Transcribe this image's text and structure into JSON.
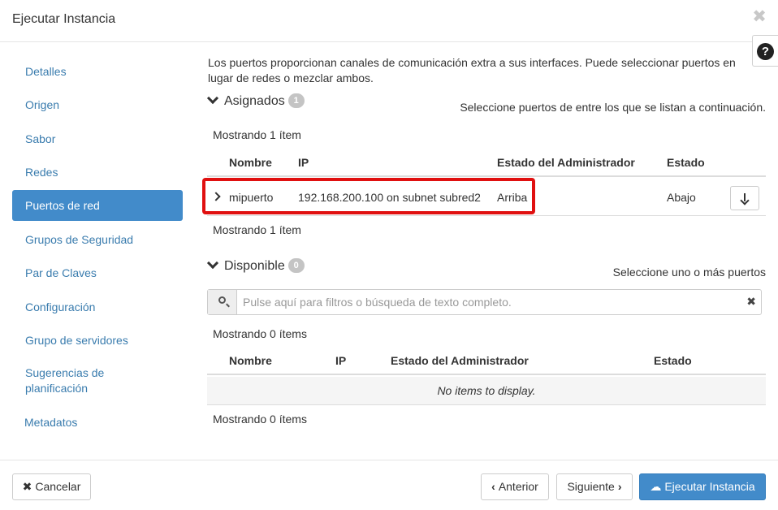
{
  "modal": {
    "title": "Ejecutar Instancia",
    "close_glyph": "✖",
    "help_glyph": "?"
  },
  "sidebar": {
    "items": [
      {
        "label": "Detalles"
      },
      {
        "label": "Origen"
      },
      {
        "label": "Sabor"
      },
      {
        "label": "Redes"
      },
      {
        "label": "Puertos de red",
        "active": true
      },
      {
        "label": "Grupos de Seguridad"
      },
      {
        "label": "Par de Claves"
      },
      {
        "label": "Configuración"
      },
      {
        "label": "Grupo de servidores"
      },
      {
        "label_line1": "Sugerencias de",
        "label_line2": "planificación"
      },
      {
        "label": "Metadatos"
      }
    ]
  },
  "main": {
    "description_line1": "Los puertos proporcionan canales de comunicación extra a sus interfaces. Puede seleccionar puertos en",
    "description_line2": "lugar de redes o mezclar ambos.",
    "assigned": {
      "title": "Asignados",
      "badge": "1",
      "hint": "Seleccione puertos de entre los que se listan a continuación.",
      "count_top": "Mostrando 1 ítem",
      "count_bottom": "Mostrando 1 ítem",
      "columns": [
        "Nombre",
        "IP",
        "Estado del Administrador",
        "Estado"
      ],
      "rows": [
        {
          "name": "mipuerto",
          "ip": "192.168.200.100 on subnet subred2",
          "admin_state": "Arriba",
          "state": "Abajo"
        }
      ]
    },
    "available": {
      "title": "Disponible",
      "badge": "0",
      "hint": "Seleccione uno o más puertos",
      "search_placeholder": "Pulse aquí para filtros o búsqueda de texto completo.",
      "count_top": "Mostrando 0 ítems",
      "count_bottom": "Mostrando 0 ítems",
      "columns": [
        "Nombre",
        "IP",
        "Estado del Administrador",
        "Estado"
      ],
      "empty_text": "No items to display."
    }
  },
  "footer": {
    "cancel_label": "Cancelar",
    "prev_label": "Anterior",
    "next_label": "Siguiente",
    "launch_label": "Ejecutar Instancia"
  },
  "colors": {
    "primary": "#428bca",
    "link": "#3a7cae",
    "highlight": "#e01010"
  }
}
